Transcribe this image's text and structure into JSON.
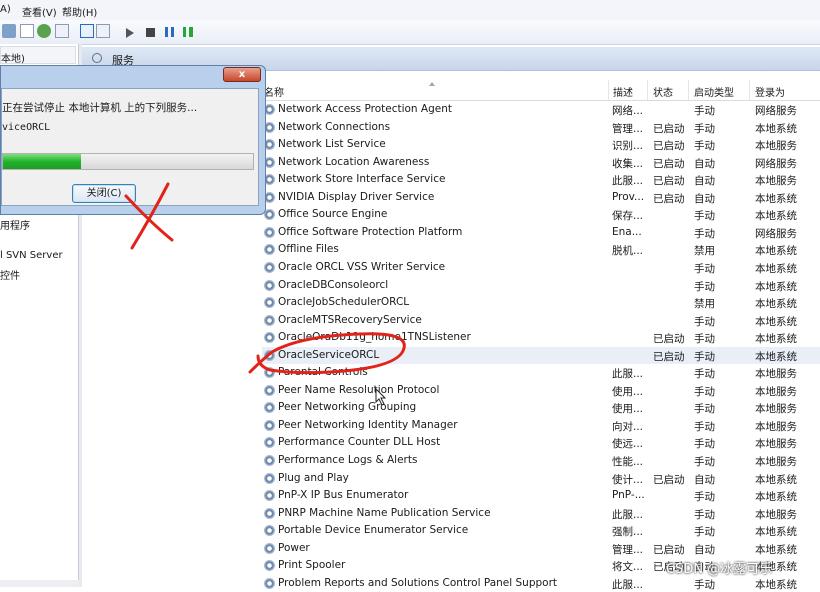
{
  "menubar": {
    "items": [
      {
        "label": "A)"
      },
      {
        "label": "查看(V)"
      },
      {
        "label": "帮助(H)"
      }
    ]
  },
  "toolbar": {
    "icons": [
      "back-arrow-icon",
      "forward-arrow-icon",
      "up-icon",
      "show-hide-tree-icon",
      "refresh-icon",
      "export-icon",
      "help-icon",
      "properties-icon",
      "play-icon",
      "stop-icon",
      "pause-icon",
      "restart-icon"
    ]
  },
  "leftpane": {
    "selected_label": "本地)",
    "items": [
      {
        "label": "用程序"
      },
      {
        "label": "l SVN Server"
      },
      {
        "label": "控件"
      }
    ]
  },
  "panel": {
    "title": "服务"
  },
  "columns": {
    "name": "名称",
    "description": "描述",
    "status": "状态",
    "startup": "启动类型",
    "logon": "登录为"
  },
  "services": [
    {
      "name": "Network Access Protection Agent",
      "description": "网络...",
      "status": "",
      "startup": "手动",
      "logon": "网络服务"
    },
    {
      "name": "Network Connections",
      "description": "管理...",
      "status": "已启动",
      "startup": "手动",
      "logon": "本地系统"
    },
    {
      "name": "Network List Service",
      "description": "识别...",
      "status": "已启动",
      "startup": "手动",
      "logon": "本地服务"
    },
    {
      "name": "Network Location Awareness",
      "description": "收集...",
      "status": "已启动",
      "startup": "自动",
      "logon": "网络服务"
    },
    {
      "name": "Network Store Interface Service",
      "description": "此服...",
      "status": "已启动",
      "startup": "自动",
      "logon": "本地服务"
    },
    {
      "name": "NVIDIA Display Driver Service",
      "description": "Prov...",
      "status": "已启动",
      "startup": "自动",
      "logon": "本地系统"
    },
    {
      "name": "Office  Source Engine",
      "description": "保存...",
      "status": "",
      "startup": "手动",
      "logon": "本地系统"
    },
    {
      "name": "Office Software Protection Platform",
      "description": "Ena...",
      "status": "",
      "startup": "手动",
      "logon": "网络服务"
    },
    {
      "name": "Offline Files",
      "description": "脱机...",
      "status": "",
      "startup": "禁用",
      "logon": "本地系统"
    },
    {
      "name": "Oracle ORCL VSS Writer Service",
      "description": "",
      "status": "",
      "startup": "手动",
      "logon": "本地系统"
    },
    {
      "name": "OracleDBConsoleorcl",
      "description": "",
      "status": "",
      "startup": "手动",
      "logon": "本地系统"
    },
    {
      "name": "OracleJobSchedulerORCL",
      "description": "",
      "status": "",
      "startup": "禁用",
      "logon": "本地系统"
    },
    {
      "name": "OracleMTSRecoveryService",
      "description": "",
      "status": "",
      "startup": "手动",
      "logon": "本地系统"
    },
    {
      "name": "OracleOraDb11g_home1TNSListener",
      "description": "",
      "status": "已启动",
      "startup": "手动",
      "logon": "本地系统"
    },
    {
      "name": "OracleServiceORCL",
      "description": "",
      "status": "已启动",
      "startup": "手动",
      "logon": "本地系统"
    },
    {
      "name": "Parental Controls",
      "description": "此服...",
      "status": "",
      "startup": "手动",
      "logon": "本地服务"
    },
    {
      "name": "Peer Name Resolution Protocol",
      "description": "使用...",
      "status": "",
      "startup": "手动",
      "logon": "本地服务"
    },
    {
      "name": "Peer Networking Grouping",
      "description": "使用...",
      "status": "",
      "startup": "手动",
      "logon": "本地服务"
    },
    {
      "name": "Peer Networking Identity Manager",
      "description": "向对...",
      "status": "",
      "startup": "手动",
      "logon": "本地服务"
    },
    {
      "name": "Performance Counter DLL Host",
      "description": "使远...",
      "status": "",
      "startup": "手动",
      "logon": "本地服务"
    },
    {
      "name": "Performance Logs & Alerts",
      "description": "性能...",
      "status": "",
      "startup": "手动",
      "logon": "本地服务"
    },
    {
      "name": "Plug and Play",
      "description": "使计...",
      "status": "已启动",
      "startup": "自动",
      "logon": "本地系统"
    },
    {
      "name": "PnP-X IP Bus Enumerator",
      "description": "PnP-...",
      "status": "",
      "startup": "手动",
      "logon": "本地系统"
    },
    {
      "name": "PNRP Machine Name Publication Service",
      "description": "此服...",
      "status": "",
      "startup": "手动",
      "logon": "本地服务"
    },
    {
      "name": "Portable Device Enumerator Service",
      "description": "强制...",
      "status": "",
      "startup": "手动",
      "logon": "本地系统"
    },
    {
      "name": "Power",
      "description": "管理...",
      "status": "已启动",
      "startup": "自动",
      "logon": "本地系统"
    },
    {
      "name": "Print Spooler",
      "description": "将文...",
      "status": "已启动",
      "startup": "自动",
      "logon": "本地系统"
    },
    {
      "name": "Problem Reports and Solutions Control Panel Support",
      "description": "此服...",
      "status": "",
      "startup": "手动",
      "logon": "本地系统"
    }
  ],
  "dialog": {
    "message": "正在尝试停止 本地计算机 上的下列服务...",
    "service": "viceORCL",
    "close_label": "关闭(C)",
    "progress": 0.31,
    "close_x": "x"
  },
  "watermark": "CSDN @冰露可乐",
  "colors": {
    "annotation": "#e2231a",
    "progress": "#22b32b",
    "header": "#c7d6ea"
  }
}
